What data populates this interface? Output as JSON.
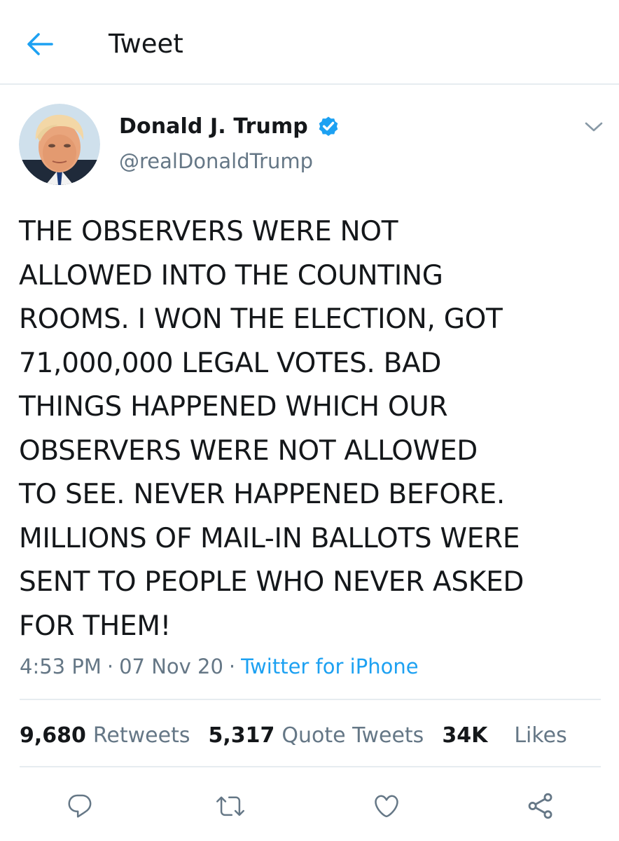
{
  "header": {
    "title": "Tweet"
  },
  "author": {
    "display_name": "Donald J. Trump",
    "handle": "@realDonaldTrump",
    "verified": true
  },
  "tweet": {
    "text": "THE OBSERVERS WERE NOT\nALLOWED INTO THE COUNTING\nROOMS. I WON THE ELECTION, GOT\n71,000,000 LEGAL VOTES. BAD\nTHINGS HAPPENED WHICH OUR\nOBSERVERS WERE NOT ALLOWED\nTO SEE. NEVER HAPPENED BEFORE.\nMILLIONS OF MAIL-IN BALLOTS WERE\nSENT TO PEOPLE WHO NEVER ASKED\nFOR THEM!",
    "time": "4:53 PM",
    "date": "07 Nov 20",
    "source": "Twitter for iPhone",
    "separator": "·"
  },
  "stats": {
    "retweets": {
      "count": "9,680",
      "label": "Retweets"
    },
    "quote_tweets": {
      "count": "5,317",
      "label": "Quote Tweets"
    },
    "likes": {
      "count": "34K",
      "label": "Likes"
    }
  },
  "icons": {
    "back": "arrow-left-icon",
    "verified": "verified-badge-icon",
    "caret": "chevron-down-icon",
    "reply": "reply-icon",
    "retweet": "retweet-icon",
    "like": "heart-icon",
    "share": "share-icon"
  },
  "colors": {
    "accent": "#1da1f2",
    "text": "#14171a",
    "secondary": "#657786",
    "divider": "#e6ecf0"
  }
}
